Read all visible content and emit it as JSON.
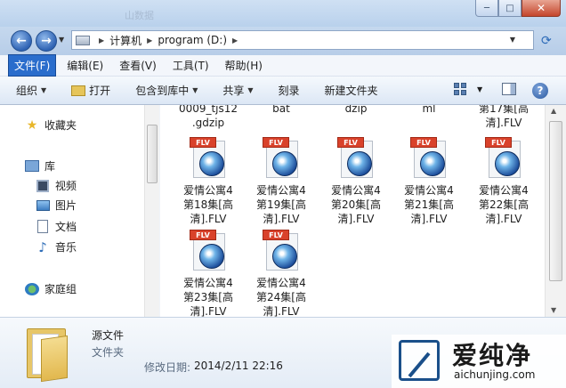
{
  "window": {
    "ghost_title": "山数据",
    "min_glyph": "─",
    "max_glyph": "□",
    "close_glyph": "✕"
  },
  "address": {
    "back_glyph": "←",
    "forward_glyph": "→",
    "crumbs": [
      "计算机",
      "program (D:)"
    ],
    "refresh_glyph": "⟳"
  },
  "menu": [
    "文件(F)",
    "编辑(E)",
    "查看(V)",
    "工具(T)",
    "帮助(H)"
  ],
  "toolbar": {
    "organize": "组织",
    "open": "打开",
    "include_in_library": "包含到库中",
    "share": "共享",
    "burn": "刻录",
    "new_folder": "新建文件夹"
  },
  "sidebar": {
    "favorites": "收藏夹",
    "libraries": "库",
    "videos": "视频",
    "pictures": "图片",
    "documents": "文档",
    "music": "音乐",
    "homegroup": "家庭组"
  },
  "top_row_names": [
    "0009_tjs12\n.gdzip",
    "bat",
    "dzip",
    "ml",
    "第17集[高\n清].FLV"
  ],
  "files": [
    {
      "badge": "FLV",
      "name": "爱情公寓4\n第18集[高\n清].FLV"
    },
    {
      "badge": "FLV",
      "name": "爱情公寓4\n第19集[高\n清].FLV"
    },
    {
      "badge": "FLV",
      "name": "爱情公寓4\n第20集[高\n清].FLV"
    },
    {
      "badge": "FLV",
      "name": "爱情公寓4\n第21集[高\n清].FLV"
    },
    {
      "badge": "FLV",
      "name": "爱情公寓4\n第22集[高\n清].FLV"
    },
    {
      "badge": "FLV",
      "name": "爱情公寓4\n第23集[高\n清].FLV"
    },
    {
      "badge": "FLV",
      "name": "爱情公寓4\n第24集[高\n清].FLV"
    }
  ],
  "details": {
    "name": "源文件",
    "type": "文件夹",
    "date_label": "修改日期:",
    "date_value": "2014/2/11 22:16"
  },
  "watermark": {
    "text": "爱纯净",
    "url": "aichunjing.com"
  }
}
